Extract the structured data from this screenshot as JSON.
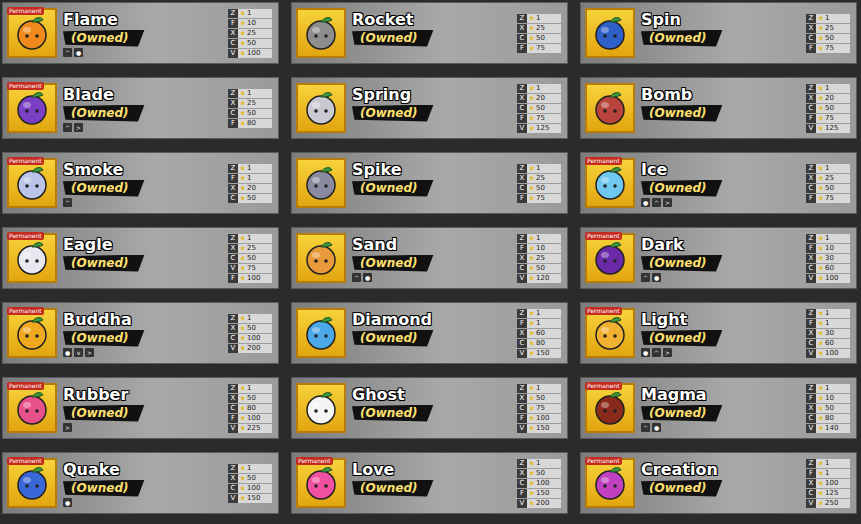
{
  "fruits": [
    {
      "name": "Flame",
      "status": "(Owned)",
      "permanent": true,
      "badge": "Permanent",
      "color": "#f08a1c",
      "tags": [
        "^",
        "●"
      ],
      "stats": [
        {
          "key": "Z",
          "value": "1"
        },
        {
          "key": "F",
          "value": "10"
        },
        {
          "key": "X",
          "value": "25"
        },
        {
          "key": "C",
          "value": "50"
        },
        {
          "key": "V",
          "value": "100"
        }
      ]
    },
    {
      "name": "Rocket",
      "status": "(Owned)",
      "permanent": false,
      "badge": "",
      "color": "#8e8e8e",
      "tags": [],
      "stats": [
        {
          "key": "Z",
          "value": "1"
        },
        {
          "key": "X",
          "value": "25"
        },
        {
          "key": "C",
          "value": "50"
        },
        {
          "key": "F",
          "value": "75"
        }
      ]
    },
    {
      "name": "Spin",
      "status": "(Owned)",
      "permanent": false,
      "badge": "",
      "color": "#2f5fc8",
      "tags": [],
      "stats": [
        {
          "key": "Z",
          "value": "1"
        },
        {
          "key": "X",
          "value": "25"
        },
        {
          "key": "C",
          "value": "50"
        },
        {
          "key": "F",
          "value": "75"
        }
      ]
    },
    {
      "name": "Blade",
      "status": "(Owned)",
      "permanent": true,
      "badge": "Permanent",
      "color": "#7a3fc4",
      "tags": [
        "^",
        ">"
      ],
      "stats": [
        {
          "key": "Z",
          "value": "1"
        },
        {
          "key": "X",
          "value": "25"
        },
        {
          "key": "C",
          "value": "50"
        },
        {
          "key": "F",
          "value": "80"
        }
      ]
    },
    {
      "name": "Spring",
      "status": "(Owned)",
      "permanent": false,
      "badge": "",
      "color": "#c9c9d2",
      "tags": [],
      "stats": [
        {
          "key": "Z",
          "value": "1"
        },
        {
          "key": "X",
          "value": "20"
        },
        {
          "key": "C",
          "value": "50"
        },
        {
          "key": "F",
          "value": "75"
        },
        {
          "key": "V",
          "value": "125"
        }
      ]
    },
    {
      "name": "Bomb",
      "status": "(Owned)",
      "permanent": false,
      "badge": "",
      "color": "#b8443c",
      "tags": [],
      "stats": [
        {
          "key": "Z",
          "value": "1"
        },
        {
          "key": "X",
          "value": "20"
        },
        {
          "key": "C",
          "value": "50"
        },
        {
          "key": "F",
          "value": "75"
        },
        {
          "key": "V",
          "value": "125"
        }
      ]
    },
    {
      "name": "Smoke",
      "status": "(Owned)",
      "permanent": true,
      "badge": "Permanent",
      "color": "#b9c4e8",
      "tags": [
        "^"
      ],
      "stats": [
        {
          "key": "Z",
          "value": "1"
        },
        {
          "key": "F",
          "value": "1"
        },
        {
          "key": "X",
          "value": "20"
        },
        {
          "key": "C",
          "value": "50"
        }
      ]
    },
    {
      "name": "Spike",
      "status": "(Owned)",
      "permanent": false,
      "badge": "",
      "color": "#8a8aa0",
      "tags": [],
      "stats": [
        {
          "key": "Z",
          "value": "1"
        },
        {
          "key": "X",
          "value": "25"
        },
        {
          "key": "C",
          "value": "50"
        },
        {
          "key": "F",
          "value": "75"
        }
      ]
    },
    {
      "name": "Ice",
      "status": "(Owned)",
      "permanent": true,
      "badge": "Permanent",
      "color": "#6fc8f0",
      "tags": [
        "●",
        "^",
        ">"
      ],
      "stats": [
        {
          "key": "Z",
          "value": "1"
        },
        {
          "key": "X",
          "value": "25"
        },
        {
          "key": "C",
          "value": "50"
        },
        {
          "key": "F",
          "value": "75"
        }
      ]
    },
    {
      "name": "Eagle",
      "status": "(Owned)",
      "permanent": true,
      "badge": "Permanent",
      "color": "#e8e8f0",
      "tags": [],
      "stats": [
        {
          "key": "Z",
          "value": "1"
        },
        {
          "key": "X",
          "value": "25"
        },
        {
          "key": "C",
          "value": "50"
        },
        {
          "key": "V",
          "value": "75"
        },
        {
          "key": "F",
          "value": "100"
        }
      ]
    },
    {
      "name": "Sand",
      "status": "(Owned)",
      "permanent": false,
      "badge": "",
      "color": "#e89a3a",
      "tags": [
        "^",
        "●"
      ],
      "stats": [
        {
          "key": "Z",
          "value": "1"
        },
        {
          "key": "F",
          "value": "10"
        },
        {
          "key": "X",
          "value": "25"
        },
        {
          "key": "C",
          "value": "50"
        },
        {
          "key": "V",
          "value": "120"
        }
      ]
    },
    {
      "name": "Dark",
      "status": "(Owned)",
      "permanent": true,
      "badge": "Permanent",
      "color": "#6a2aa8",
      "tags": [
        "^",
        "●"
      ],
      "stats": [
        {
          "key": "Z",
          "value": "1"
        },
        {
          "key": "F",
          "value": "10"
        },
        {
          "key": "X",
          "value": "30"
        },
        {
          "key": "C",
          "value": "60"
        },
        {
          "key": "V",
          "value": "100"
        }
      ]
    },
    {
      "name": "Buddha",
      "status": "(Owned)",
      "permanent": true,
      "badge": "Permanent",
      "color": "#f0a820",
      "tags": [
        "●",
        "v",
        ">"
      ],
      "stats": [
        {
          "key": "Z",
          "value": "1"
        },
        {
          "key": "X",
          "value": "50"
        },
        {
          "key": "C",
          "value": "100"
        },
        {
          "key": "V",
          "value": "200"
        }
      ]
    },
    {
      "name": "Diamond",
      "status": "(Owned)",
      "permanent": false,
      "badge": "",
      "color": "#4aa8e8",
      "tags": [],
      "stats": [
        {
          "key": "Z",
          "value": "1"
        },
        {
          "key": "F",
          "value": "1"
        },
        {
          "key": "X",
          "value": "60"
        },
        {
          "key": "C",
          "value": "80"
        },
        {
          "key": "V",
          "value": "150"
        }
      ]
    },
    {
      "name": "Light",
      "status": "(Owned)",
      "permanent": true,
      "badge": "Permanent",
      "color": "#f0b030",
      "tags": [
        "●",
        "^",
        ">"
      ],
      "stats": [
        {
          "key": "Z",
          "value": "1"
        },
        {
          "key": "F",
          "value": "1"
        },
        {
          "key": "X",
          "value": "30"
        },
        {
          "key": "C",
          "value": "60"
        },
        {
          "key": "V",
          "value": "100"
        }
      ]
    },
    {
      "name": "Rubber",
      "status": "(Owned)",
      "permanent": true,
      "badge": "Permanent",
      "color": "#e8508a",
      "tags": [
        ">"
      ],
      "stats": [
        {
          "key": "Z",
          "value": "1"
        },
        {
          "key": "X",
          "value": "50"
        },
        {
          "key": "C",
          "value": "80"
        },
        {
          "key": "F",
          "value": "100"
        },
        {
          "key": "V",
          "value": "225"
        }
      ]
    },
    {
      "name": "Ghost",
      "status": "(Owned)",
      "permanent": false,
      "badge": "",
      "color": "#f4f4f4",
      "tags": [],
      "stats": [
        {
          "key": "Z",
          "value": "1"
        },
        {
          "key": "X",
          "value": "50"
        },
        {
          "key": "C",
          "value": "75"
        },
        {
          "key": "F",
          "value": "100"
        },
        {
          "key": "V",
          "value": "150"
        }
      ]
    },
    {
      "name": "Magma",
      "status": "(Owned)",
      "permanent": true,
      "badge": "Permanent",
      "color": "#8a2a1a",
      "tags": [
        "^",
        "●"
      ],
      "stats": [
        {
          "key": "Z",
          "value": "1"
        },
        {
          "key": "F",
          "value": "10"
        },
        {
          "key": "X",
          "value": "50"
        },
        {
          "key": "C",
          "value": "80"
        },
        {
          "key": "V",
          "value": "140"
        }
      ]
    },
    {
      "name": "Quake",
      "status": "(Owned)",
      "permanent": true,
      "badge": "Permanent",
      "color": "#3a68d8",
      "tags": [
        "●"
      ],
      "stats": [
        {
          "key": "Z",
          "value": "1"
        },
        {
          "key": "X",
          "value": "50"
        },
        {
          "key": "C",
          "value": "100"
        },
        {
          "key": "V",
          "value": "150"
        }
      ]
    },
    {
      "name": "Love",
      "status": "(Owned)",
      "permanent": true,
      "badge": "Permanent",
      "color": "#f050a0",
      "tags": [],
      "stats": [
        {
          "key": "Z",
          "value": "1"
        },
        {
          "key": "X",
          "value": "50"
        },
        {
          "key": "C",
          "value": "100"
        },
        {
          "key": "F",
          "value": "150"
        },
        {
          "key": "V",
          "value": "200"
        }
      ]
    },
    {
      "name": "Creation",
      "status": "(Owned)",
      "permanent": true,
      "badge": "Permanent",
      "color": "#c040c0",
      "tags": [],
      "stats": [
        {
          "key": "Z",
          "value": "1"
        },
        {
          "key": "F",
          "value": "1"
        },
        {
          "key": "X",
          "value": "100"
        },
        {
          "key": "C",
          "value": "125"
        },
        {
          "key": "V",
          "value": "250"
        }
      ]
    }
  ]
}
